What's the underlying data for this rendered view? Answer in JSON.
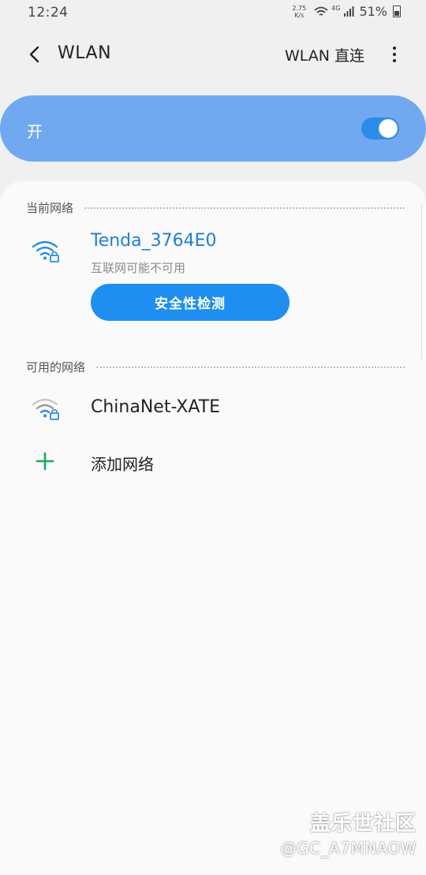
{
  "status_bar": {
    "time": "12:24",
    "speed_value": "2.75",
    "speed_unit": "K/s",
    "network": "4G",
    "battery": "51%"
  },
  "header": {
    "title": "WLAN",
    "direct_label": "WLAN 直连"
  },
  "wifi_toggle": {
    "label": "开",
    "state": "on",
    "accent_color": "#70a9f0"
  },
  "current_network": {
    "section_label": "当前网络",
    "name": "Tenda_3764E0",
    "status": "互联网可能不可用",
    "icon": "wifi-lock-icon",
    "name_color": "#1e7fd8",
    "action_label": "安全性检测"
  },
  "available_networks": {
    "section_label": "可用的网络",
    "items": [
      {
        "name": "ChinaNet-XATE",
        "icon": "wifi-lock-icon"
      }
    ],
    "add_label": "添加网络"
  },
  "watermark": {
    "brand": "盖乐世社区",
    "user": "@GC_A7MNAOW"
  }
}
